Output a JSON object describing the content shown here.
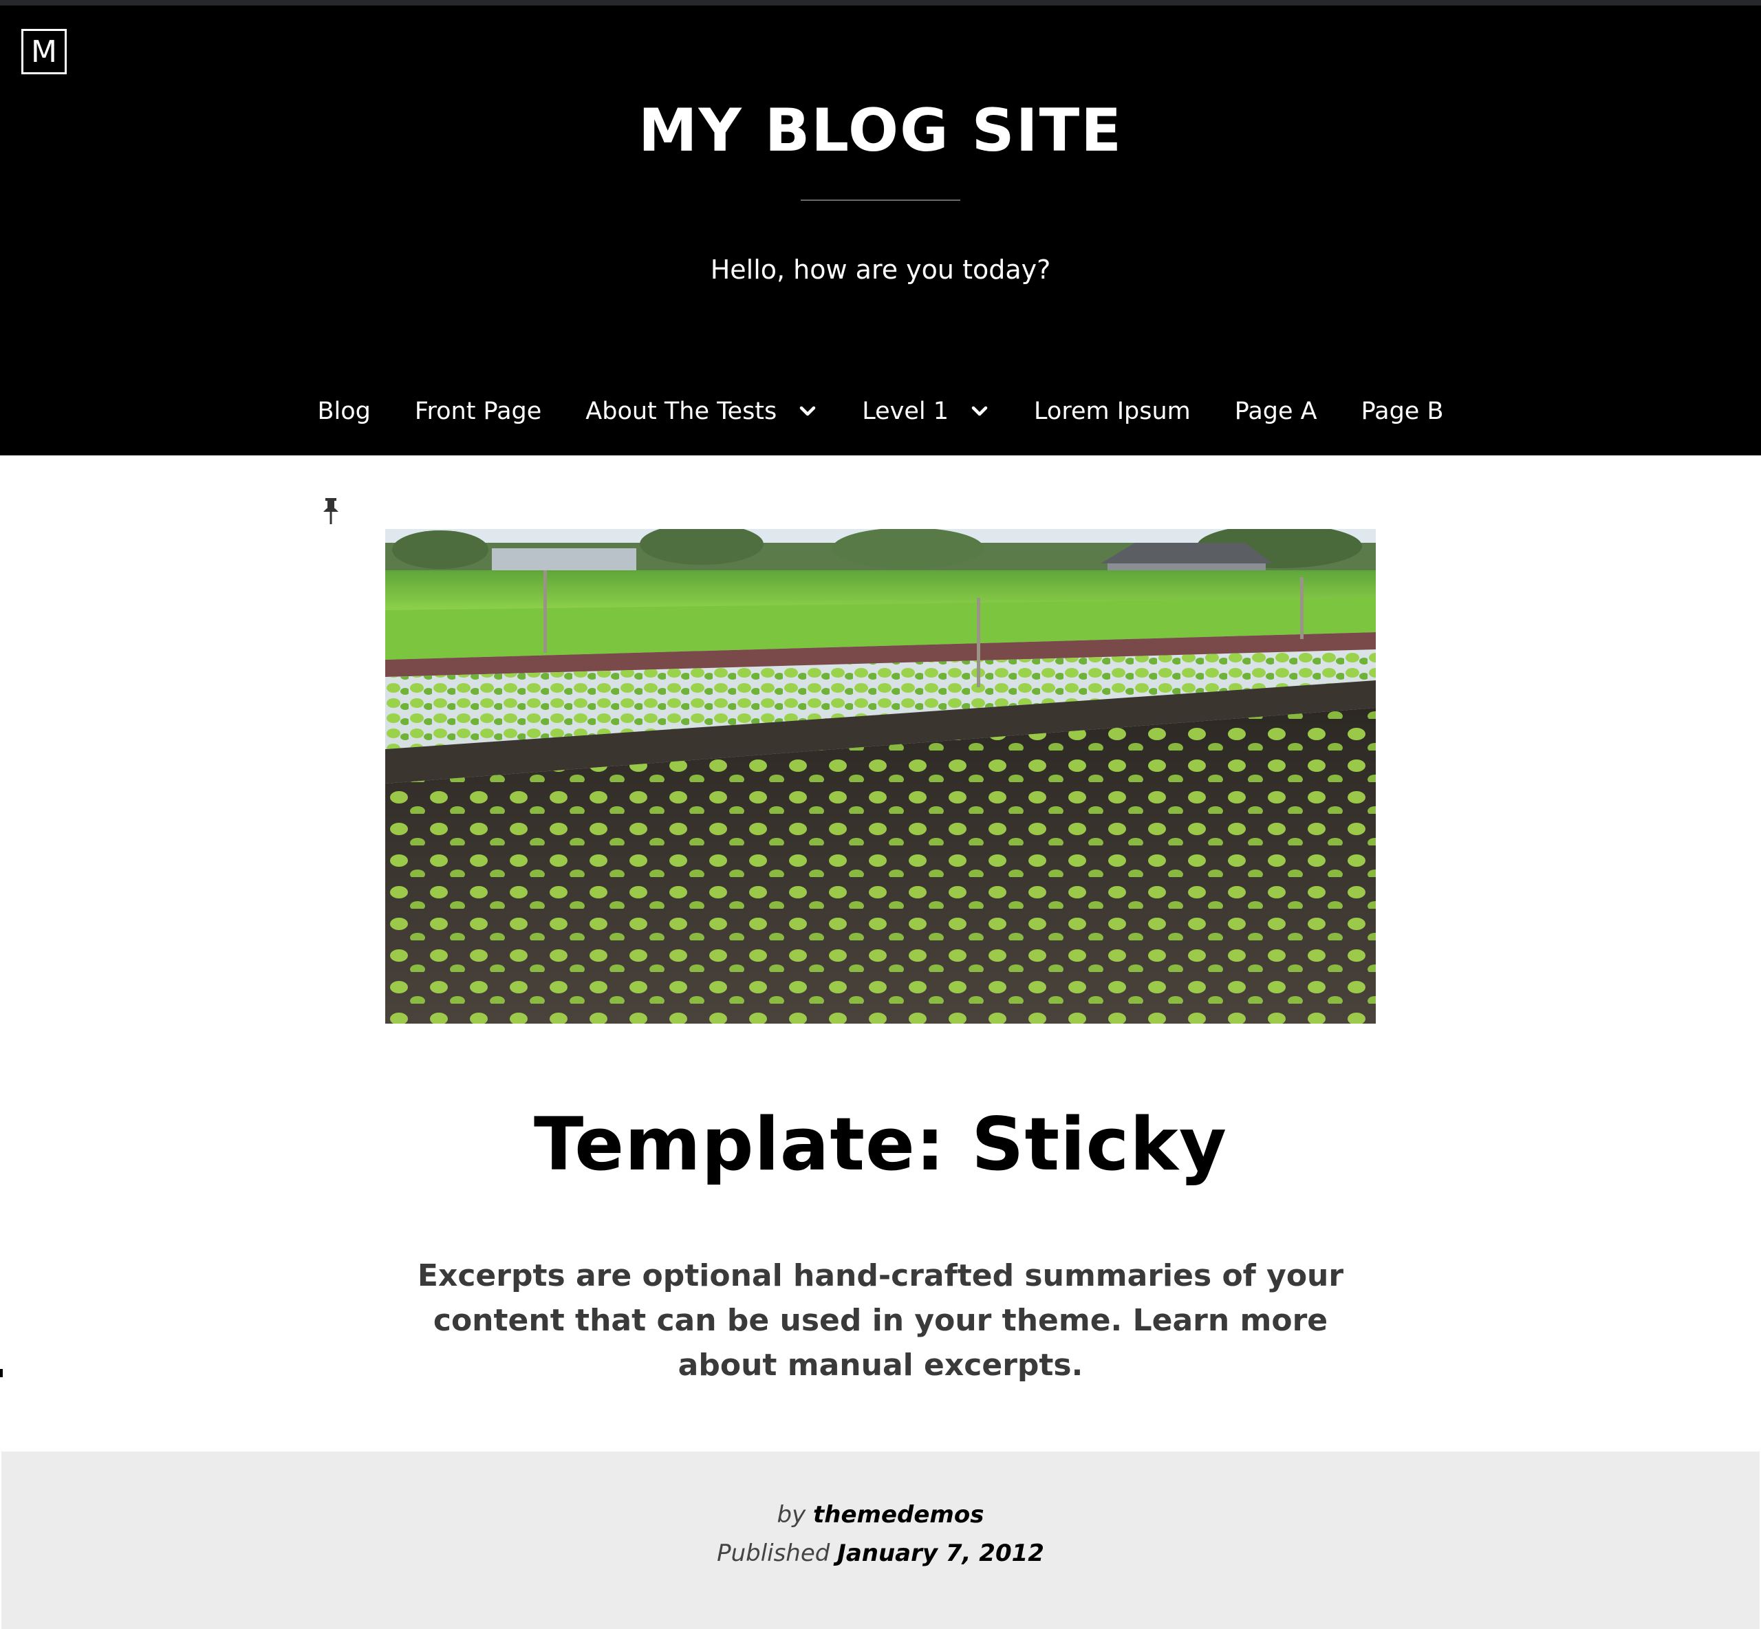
{
  "header": {
    "logo_letter": "M",
    "site_title": "MY BLOG SITE",
    "tagline": "Hello, how are you today?",
    "background": "#000000"
  },
  "nav": {
    "items": [
      {
        "label": "Blog",
        "has_submenu": false
      },
      {
        "label": "Front Page",
        "has_submenu": false
      },
      {
        "label": "About The Tests",
        "has_submenu": true
      },
      {
        "label": "Level 1",
        "has_submenu": true
      },
      {
        "label": "Lorem Ipsum",
        "has_submenu": false
      },
      {
        "label": "Page A",
        "has_submenu": false
      },
      {
        "label": "Page B",
        "has_submenu": false
      }
    ]
  },
  "post": {
    "sticky_icon": "pushpin-icon",
    "featured_image": "lettuce-field-photo",
    "title": "Template: Sticky",
    "excerpt": "Excerpts are optional hand-crafted summaries of your content that can be used in your theme. Learn more about manual excerpts.",
    "meta": {
      "by_prefix": "by",
      "author": "themedemos",
      "published_prefix": "Published",
      "date": "January 7, 2012"
    }
  }
}
